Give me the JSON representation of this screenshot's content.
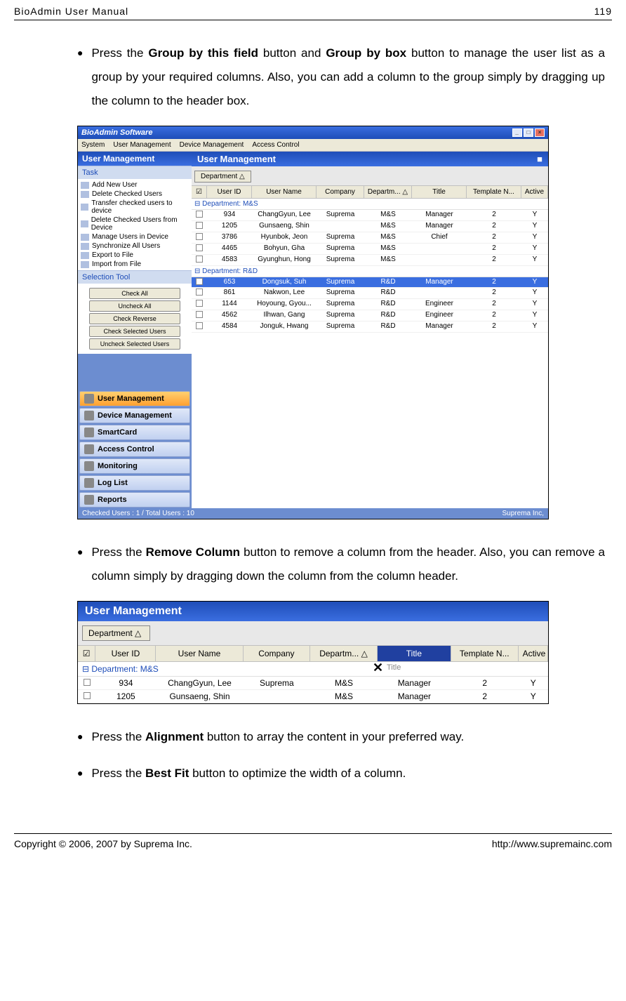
{
  "header": {
    "left": "BioAdmin User Manual",
    "right": "119"
  },
  "bullets": {
    "b1_pre": "Press the ",
    "b1_bold1": "Group by this field",
    "b1_mid1": " button and ",
    "b1_bold2": "Group by box",
    "b1_post": " button to manage the user list as a group by your required columns. Also, you can add a column to the group simply by dragging up the column to the header box.",
    "b2_pre": "Press the ",
    "b2_bold": "Remove Column",
    "b2_post": " button to remove a column from the header. Also, you can remove a column simply by dragging down the column from the column header.",
    "b3_pre": "Press the ",
    "b3_bold": "Alignment",
    "b3_post": " button to array the content in your preferred way.",
    "b4_pre": "Press the ",
    "b4_bold": "Best Fit",
    "b4_post": " button to optimize the width of a column."
  },
  "ss1": {
    "win_title": "BioAdmin Software",
    "menus": [
      "System",
      "User Management",
      "Device Management",
      "Access Control"
    ],
    "sidebar_title": "User Management",
    "task_title": "Task",
    "tasks": [
      "Add New User",
      "Delete Checked Users",
      "Transfer checked users to device",
      "Delete Checked Users from Device",
      "Manage Users in Device",
      "Synchronize All Users",
      "Export to File",
      "Import from File"
    ],
    "sel_title": "Selection Tool",
    "sel_btns": [
      "Check All",
      "Uncheck All",
      "Check Reverse",
      "Check Selected Users",
      "Uncheck Selected Users"
    ],
    "navs": [
      "User Management",
      "Device Management",
      "SmartCard",
      "Access Control",
      "Monitoring",
      "Log List",
      "Reports"
    ],
    "main_title": "User Management",
    "group_chip": "Department    △",
    "cols": {
      "chk": "☑",
      "id": "User ID",
      "name": "User Name",
      "comp": "Company",
      "dept": "Departm... △",
      "title": "Title",
      "tpl": "Template N...",
      "act": "Active"
    },
    "group1": "⊟ Department: M&S",
    "group2": "⊟ Department: R&D",
    "rows1": [
      {
        "id": "934",
        "name": "ChangGyun, Lee",
        "comp": "Suprema",
        "dept": "M&S",
        "title": "Manager",
        "tpl": "2",
        "act": "Y"
      },
      {
        "id": "1205",
        "name": "Gunsaeng, Shin",
        "comp": "",
        "dept": "M&S",
        "title": "Manager",
        "tpl": "2",
        "act": "Y"
      },
      {
        "id": "3786",
        "name": "Hyunbok, Jeon",
        "comp": "Suprema",
        "dept": "M&S",
        "title": "Chief",
        "tpl": "2",
        "act": "Y"
      },
      {
        "id": "4465",
        "name": "Bohyun, Gha",
        "comp": "Suprema",
        "dept": "M&S",
        "title": "",
        "tpl": "2",
        "act": "Y"
      },
      {
        "id": "4583",
        "name": "Gyunghun, Hong",
        "comp": "Suprema",
        "dept": "M&S",
        "title": "",
        "tpl": "2",
        "act": "Y"
      }
    ],
    "rows2": [
      {
        "id": "653",
        "name": "Dongsuk, Suh",
        "comp": "Suprema",
        "dept": "R&D",
        "title": "Manager",
        "tpl": "2",
        "act": "Y",
        "sel": true
      },
      {
        "id": "861",
        "name": "Nakwon, Lee",
        "comp": "Suprema",
        "dept": "R&D",
        "title": "",
        "tpl": "2",
        "act": "Y"
      },
      {
        "id": "1144",
        "name": "Hoyoung, Gyou...",
        "comp": "Suprema",
        "dept": "R&D",
        "title": "Engineer",
        "tpl": "2",
        "act": "Y"
      },
      {
        "id": "4562",
        "name": "Ilhwan, Gang",
        "comp": "Suprema",
        "dept": "R&D",
        "title": "Engineer",
        "tpl": "2",
        "act": "Y"
      },
      {
        "id": "4584",
        "name": "Jonguk, Hwang",
        "comp": "Suprema",
        "dept": "R&D",
        "title": "Manager",
        "tpl": "2",
        "act": "Y"
      }
    ],
    "status_left": "Checked Users : 1 / Total Users : 10",
    "status_right": "Suprema Inc,"
  },
  "ss2": {
    "title": "User Management",
    "group_chip": "Department    △",
    "cols": {
      "chk": "☑",
      "id": "User ID",
      "name": "User Name",
      "comp": "Company",
      "dept": "Departm... △",
      "title": "Title",
      "tpl": "Template N...",
      "act": "Active"
    },
    "group1": "⊟ Department: M&S",
    "drag_hint": "Title",
    "rows": [
      {
        "id": "934",
        "name": "ChangGyun, Lee",
        "comp": "Suprema",
        "dept": "M&S",
        "title": "Manager",
        "tpl": "2",
        "act": "Y"
      },
      {
        "id": "1205",
        "name": "Gunsaeng, Shin",
        "comp": "",
        "dept": "M&S",
        "title": "Manager",
        "tpl": "2",
        "act": "Y"
      }
    ]
  },
  "footer": {
    "left": "Copyright © 2006, 2007 by Suprema Inc.",
    "right": "http://www.supremainc.com"
  }
}
